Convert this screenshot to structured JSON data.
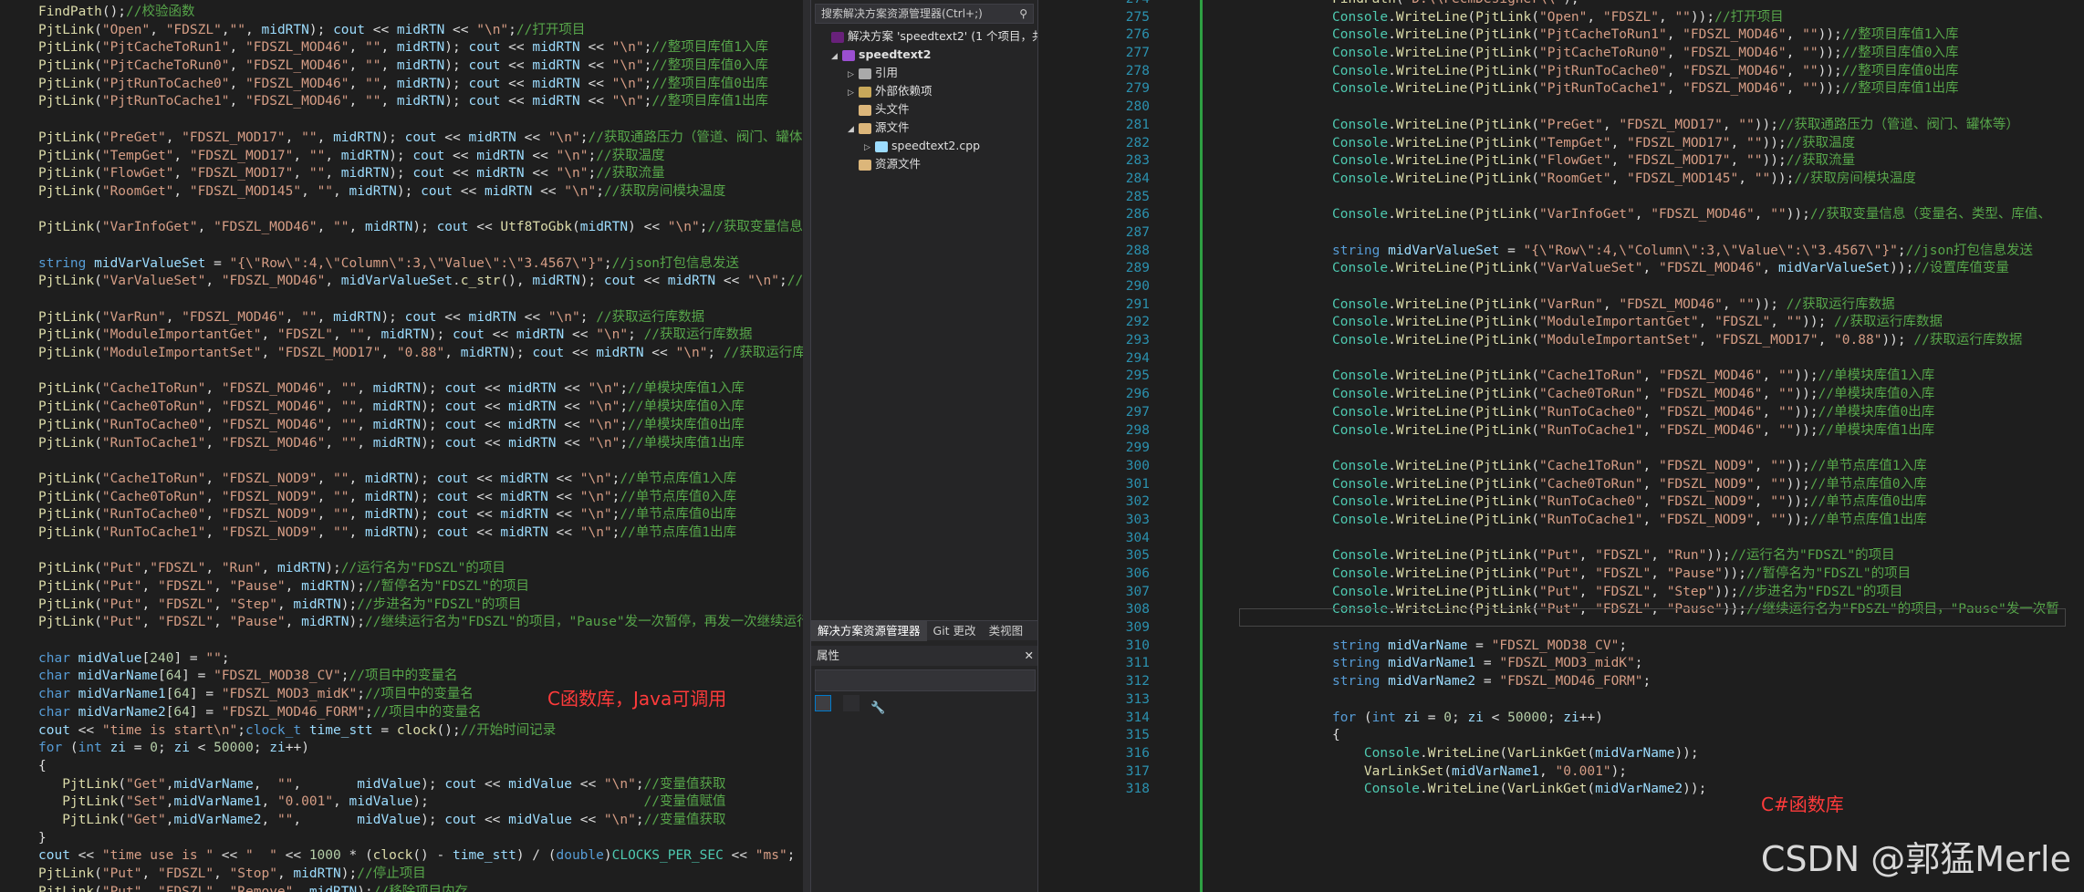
{
  "left_code": [
    [
      "FindPath();//校验函数"
    ],
    [
      "PjtLink(\"Open\", \"FDSZL\",\"\", midRTN); cout << midRTN << \"\\n\";//打开项目"
    ],
    [
      "PjtLink(\"PjtCacheToRun1\", \"FDSZL_MOD46\", \"\", midRTN); cout << midRTN << \"\\n\";//整项目库值1入库"
    ],
    [
      "PjtLink(\"PjtCacheToRun0\", \"FDSZL_MOD46\", \"\", midRTN); cout << midRTN << \"\\n\";//整项目库值0入库"
    ],
    [
      "PjtLink(\"PjtRunToCache0\", \"FDSZL_MOD46\", \"\", midRTN); cout << midRTN << \"\\n\";//整项目库值0出库"
    ],
    [
      "PjtLink(\"PjtRunToCache1\", \"FDSZL_MOD46\", \"\", midRTN); cout << midRTN << \"\\n\";//整项目库值1出库"
    ],
    [
      ""
    ],
    [
      "PjtLink(\"PreGet\", \"FDSZL_MOD17\", \"\", midRTN); cout << midRTN << \"\\n\";//获取通路压力（管道、阀门、罐体等"
    ],
    [
      "PjtLink(\"TempGet\", \"FDSZL_MOD17\", \"\", midRTN); cout << midRTN << \"\\n\";//获取温度"
    ],
    [
      "PjtLink(\"FlowGet\", \"FDSZL_MOD17\", \"\", midRTN); cout << midRTN << \"\\n\";//获取流量"
    ],
    [
      "PjtLink(\"RoomGet\", \"FDSZL_MOD145\", \"\", midRTN); cout << midRTN << \"\\n\";//获取房间模块温度"
    ],
    [
      ""
    ],
    [
      "PjtLink(\"VarInfoGet\", \"FDSZL_MOD46\", \"\", midRTN); cout << Utf8ToGbk(midRTN) << \"\\n\";//获取变量信息（变量"
    ],
    [
      ""
    ],
    [
      "string midVarValueSet = \"{\\\"Row\\\":4,\\\"Column\\\":3,\\\"Value\\\":\\\"3.4567\\\"}\";//json打包信息发送"
    ],
    [
      "PjtLink(\"VarValueSet\", \"FDSZL_MOD46\", midVarValueSet.c_str(), midRTN); cout << midRTN << \"\\n\";//设置库值"
    ],
    [
      ""
    ],
    [
      "PjtLink(\"VarRun\", \"FDSZL_MOD46\", \"\", midRTN); cout << midRTN << \"\\n\"; //获取运行库数据"
    ],
    [
      "PjtLink(\"ModuleImportantGet\", \"FDSZL\", \"\", midRTN); cout << midRTN << \"\\n\"; //获取运行库数据"
    ],
    [
      "PjtLink(\"ModuleImportantSet\", \"FDSZL_MOD17\", \"0.88\", midRTN); cout << midRTN << \"\\n\"; //获取运行库数据"
    ],
    [
      ""
    ],
    [
      "PjtLink(\"Cache1ToRun\", \"FDSZL_MOD46\", \"\", midRTN); cout << midRTN << \"\\n\";//单模块库值1入库"
    ],
    [
      "PjtLink(\"Cache0ToRun\", \"FDSZL_MOD46\", \"\", midRTN); cout << midRTN << \"\\n\";//单模块库值0入库"
    ],
    [
      "PjtLink(\"RunToCache0\", \"FDSZL_MOD46\", \"\", midRTN); cout << midRTN << \"\\n\";//单模块库值0出库"
    ],
    [
      "PjtLink(\"RunToCache1\", \"FDSZL_MOD46\", \"\", midRTN); cout << midRTN << \"\\n\";//单模块库值1出库"
    ],
    [
      ""
    ],
    [
      "PjtLink(\"Cache1ToRun\", \"FDSZL_NOD9\", \"\", midRTN); cout << midRTN << \"\\n\";//单节点库值1入库"
    ],
    [
      "PjtLink(\"Cache0ToRun\", \"FDSZL_NOD9\", \"\", midRTN); cout << midRTN << \"\\n\";//单节点库值0入库"
    ],
    [
      "PjtLink(\"RunToCache0\", \"FDSZL_NOD9\", \"\", midRTN); cout << midRTN << \"\\n\";//单节点库值0出库"
    ],
    [
      "PjtLink(\"RunToCache1\", \"FDSZL_NOD9\", \"\", midRTN); cout << midRTN << \"\\n\";//单节点库值1出库"
    ],
    [
      ""
    ],
    [
      "PjtLink(\"Put\",\"FDSZL\", \"Run\", midRTN);//运行名为\"FDSZL\"的项目"
    ],
    [
      "PjtLink(\"Put\", \"FDSZL\", \"Pause\", midRTN);//暂停名为\"FDSZL\"的项目"
    ],
    [
      "PjtLink(\"Put\", \"FDSZL\", \"Step\", midRTN);//步进名为\"FDSZL\"的项目"
    ],
    [
      "PjtLink(\"Put\", \"FDSZL\", \"Pause\", midRTN);//继续运行名为\"FDSZL\"的项目，\"Pause\"发一次暂停，再发一次继续运行"
    ],
    [
      ""
    ],
    [
      "char midValue[240] = \"\";"
    ],
    [
      "char midVarName[64] = \"FDSZL_MOD38_CV\";//项目中的变量名"
    ],
    [
      "char midVarName1[64] = \"FDSZL_MOD3_midK\";//项目中的变量名"
    ],
    [
      "char midVarName2[64] = \"FDSZL_MOD46_FORM\";//项目中的变量名"
    ],
    [
      "cout << \"time is start\\n\";clock_t time_stt = clock();//开始时间记录"
    ],
    [
      "for (int zi = 0; zi < 50000; zi++)"
    ],
    [
      "{"
    ],
    [
      "   PjtLink(\"Get\",midVarName,  \"\",       midValue); cout << midValue << \"\\n\";//变量值获取"
    ],
    [
      "   PjtLink(\"Set\",midVarName1, \"0.001\", midValue);                           //变量值赋值"
    ],
    [
      "   PjtLink(\"Get\",midVarName2, \"\",       midValue); cout << midValue << \"\\n\";//变量值获取"
    ],
    [
      "}"
    ],
    [
      "cout << \"time use is \" << \"  \" << 1000 * (clock() - time_stt) / (double)CLOCKS_PER_SEC << \"ms\";"
    ],
    [
      "PjtLink(\"Put\", \"FDSZL\", \"Stop\", midRTN);//停止项目"
    ],
    [
      "PjtLink(\"Put\", \"FDSZL\", \"Remove\", midRTN);//移除项目内存"
    ]
  ],
  "left_note": "C函数库，Java可调用",
  "solution_explorer": {
    "search_placeholder": "搜索解决方案资源管理器(Ctrl+;)",
    "items": [
      "解决方案 'speedtext2' (1 个项目，共 1",
      "speedtext2",
      "引用",
      "外部依赖项",
      "头文件",
      "源文件",
      "speedtext2.cpp",
      "资源文件"
    ],
    "tabs": [
      "解决方案资源管理器",
      "Git 更改",
      "类视图"
    ],
    "properties_title": "属性"
  },
  "right_start_line": 274,
  "right_code": [
    "FindPath(\"D:\\\\FecmDesigner\\\\\");",
    "Console.WriteLine(PjtLink(\"Open\", \"FDSZL\", \"\"));//打开项目",
    "Console.WriteLine(PjtLink(\"PjtCacheToRun1\", \"FDSZL_MOD46\", \"\"));//整项目库值1入库",
    "Console.WriteLine(PjtLink(\"PjtCacheToRun0\", \"FDSZL_MOD46\", \"\"));//整项目库值0入库",
    "Console.WriteLine(PjtLink(\"PjtRunToCache0\", \"FDSZL_MOD46\", \"\"));//整项目库值0出库",
    "Console.WriteLine(PjtLink(\"PjtRunToCache1\", \"FDSZL_MOD46\", \"\"));//整项目库值1出库",
    "",
    "Console.WriteLine(PjtLink(\"PreGet\", \"FDSZL_MOD17\", \"\"));//获取通路压力（管道、阀门、罐体等）",
    "Console.WriteLine(PjtLink(\"TempGet\", \"FDSZL_MOD17\", \"\"));//获取温度",
    "Console.WriteLine(PjtLink(\"FlowGet\", \"FDSZL_MOD17\", \"\"));//获取流量",
    "Console.WriteLine(PjtLink(\"RoomGet\", \"FDSZL_MOD145\", \"\"));//获取房间模块温度",
    "",
    "Console.WriteLine(PjtLink(\"VarInfoGet\", \"FDSZL_MOD46\", \"\"));//获取变量信息（变量名、类型、库值、",
    "",
    "string midVarValueSet = \"{\\\"Row\\\":4,\\\"Column\\\":3,\\\"Value\\\":\\\"3.4567\\\"}\";//json打包信息发送",
    "Console.WriteLine(PjtLink(\"VarValueSet\", \"FDSZL_MOD46\", midVarValueSet));//设置库值变量",
    "",
    "Console.WriteLine(PjtLink(\"VarRun\", \"FDSZL_MOD46\", \"\")); //获取运行库数据",
    "Console.WriteLine(PjtLink(\"ModuleImportantGet\", \"FDSZL\", \"\")); //获取运行库数据",
    "Console.WriteLine(PjtLink(\"ModuleImportantSet\", \"FDSZL_MOD17\", \"0.88\")); //获取运行库数据",
    "",
    "Console.WriteLine(PjtLink(\"Cache1ToRun\", \"FDSZL_MOD46\", \"\"));//单模块库值1入库",
    "Console.WriteLine(PjtLink(\"Cache0ToRun\", \"FDSZL_MOD46\", \"\"));//单模块库值0入库",
    "Console.WriteLine(PjtLink(\"RunToCache0\", \"FDSZL_MOD46\", \"\"));//单模块库值0出库",
    "Console.WriteLine(PjtLink(\"RunToCache1\", \"FDSZL_MOD46\", \"\"));//单模块库值1出库",
    "",
    "Console.WriteLine(PjtLink(\"Cache1ToRun\", \"FDSZL_NOD9\", \"\"));//单节点库值1入库",
    "Console.WriteLine(PjtLink(\"Cache0ToRun\", \"FDSZL_NOD9\", \"\"));//单节点库值0入库",
    "Console.WriteLine(PjtLink(\"RunToCache0\", \"FDSZL_NOD9\", \"\"));//单节点库值0出库",
    "Console.WriteLine(PjtLink(\"RunToCache1\", \"FDSZL_NOD9\", \"\"));//单节点库值1出库",
    "",
    "Console.WriteLine(PjtLink(\"Put\", \"FDSZL\", \"Run\"));//运行名为\"FDSZL\"的项目",
    "Console.WriteLine(PjtLink(\"Put\", \"FDSZL\", \"Pause\"));//暂停名为\"FDSZL\"的项目",
    "Console.WriteLine(PjtLink(\"Put\", \"FDSZL\", \"Step\"));//步进名为\"FDSZL\"的项目",
    "Console.WriteLine(PjtLink(\"Put\", \"FDSZL\", \"Pause\"));//继续运行名为\"FDSZL\"的项目，\"Pause\"发一次暂",
    "",
    "string midVarName = \"FDSZL_MOD38_CV\";",
    "string midVarName1 = \"FDSZL_MOD3_midK\";",
    "string midVarName2 = \"FDSZL_MOD46_FORM\";",
    "",
    "for (int zi = 0; zi < 50000; zi++)",
    "{",
    "    Console.WriteLine(VarLinkGet(midVarName));",
    "    VarLinkSet(midVarName1, \"0.001\");",
    "    Console.WriteLine(VarLinkGet(midVarName2));"
  ],
  "right_note": "C#函数库",
  "watermark": "CSDN @郭猛Merle"
}
